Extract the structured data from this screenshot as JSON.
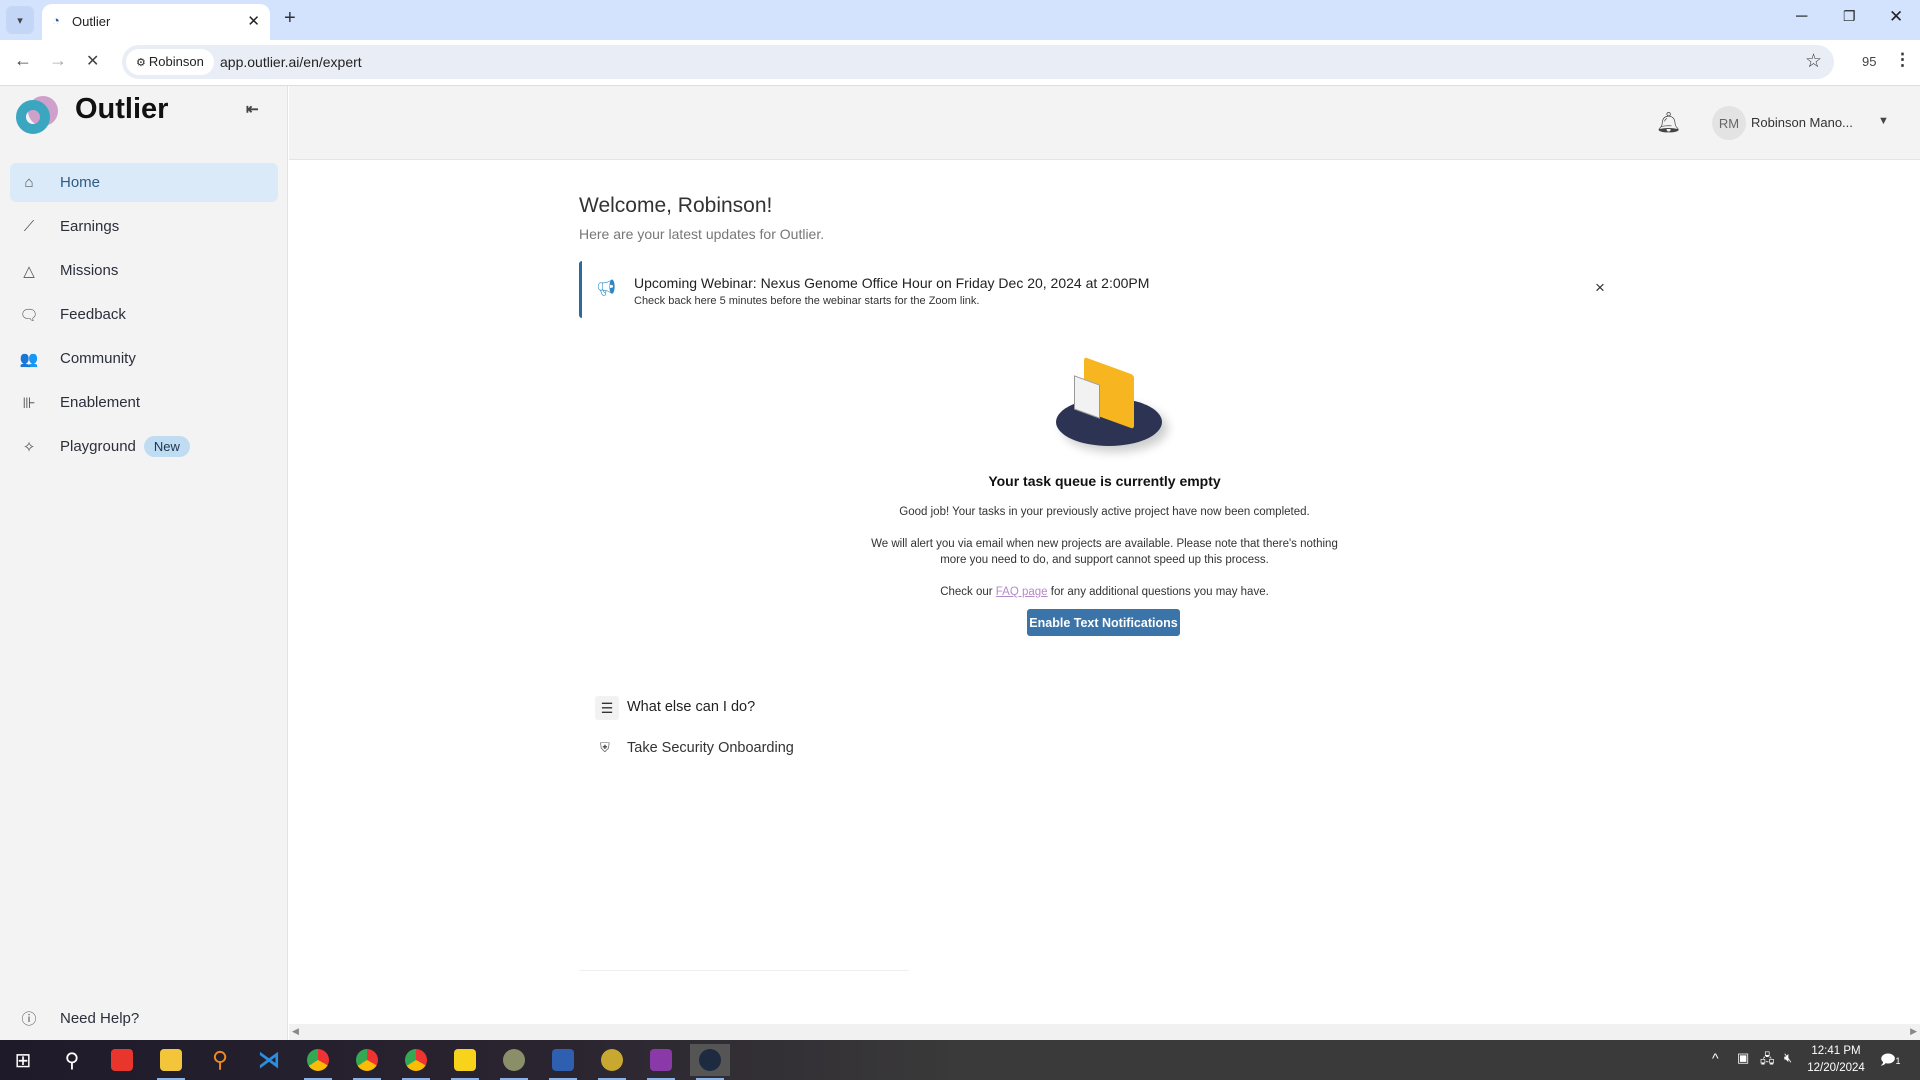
{
  "browser": {
    "tab_title": "Outlier",
    "profile_chip": "Robinson",
    "url": "app.outlier.ai/en/expert",
    "zoom": "95"
  },
  "sidebar": {
    "brand": "Outlier",
    "items": [
      {
        "label": "Home",
        "icon": "home-icon"
      },
      {
        "label": "Earnings",
        "icon": "chart-line-icon"
      },
      {
        "label": "Missions",
        "icon": "mountain-icon"
      },
      {
        "label": "Feedback",
        "icon": "chat-bubbles-icon"
      },
      {
        "label": "Community",
        "icon": "people-icon"
      },
      {
        "label": "Enablement",
        "icon": "dumbbell-icon"
      },
      {
        "label": "Playground",
        "icon": "sparkle-icon",
        "badge": "New"
      }
    ],
    "help": "Need Help?"
  },
  "header": {
    "avatar_initials": "RM",
    "user_name": "Robinson Mano..."
  },
  "main": {
    "welcome": "Welcome, Robinson!",
    "subtitle": "Here are your latest updates for Outlier.",
    "banner": {
      "title": "Upcoming Webinar: Nexus Genome Office Hour on Friday Dec 20, 2024 at 2:00PM",
      "body": "Check back here 5 minutes before the webinar starts for the Zoom link.",
      "close": "×"
    },
    "empty": {
      "title": "Your task queue is currently empty",
      "line1": "Good job! Your tasks in your previously active project have now been completed.",
      "line2": "We will alert you via email when new projects are available. Please note that there's nothing",
      "line3": "more you need to do, and support cannot speed up this process.",
      "faq_prefix": "Check our ",
      "faq_link": "FAQ page",
      "faq_suffix": " for any additional questions you may have.",
      "button": "Enable Text Notifications"
    },
    "what_else": "What else can I do?",
    "security": "Take Security Onboarding"
  },
  "taskbar": {
    "time": "12:41 PM",
    "date": "12/20/2024",
    "notifications": "1"
  }
}
